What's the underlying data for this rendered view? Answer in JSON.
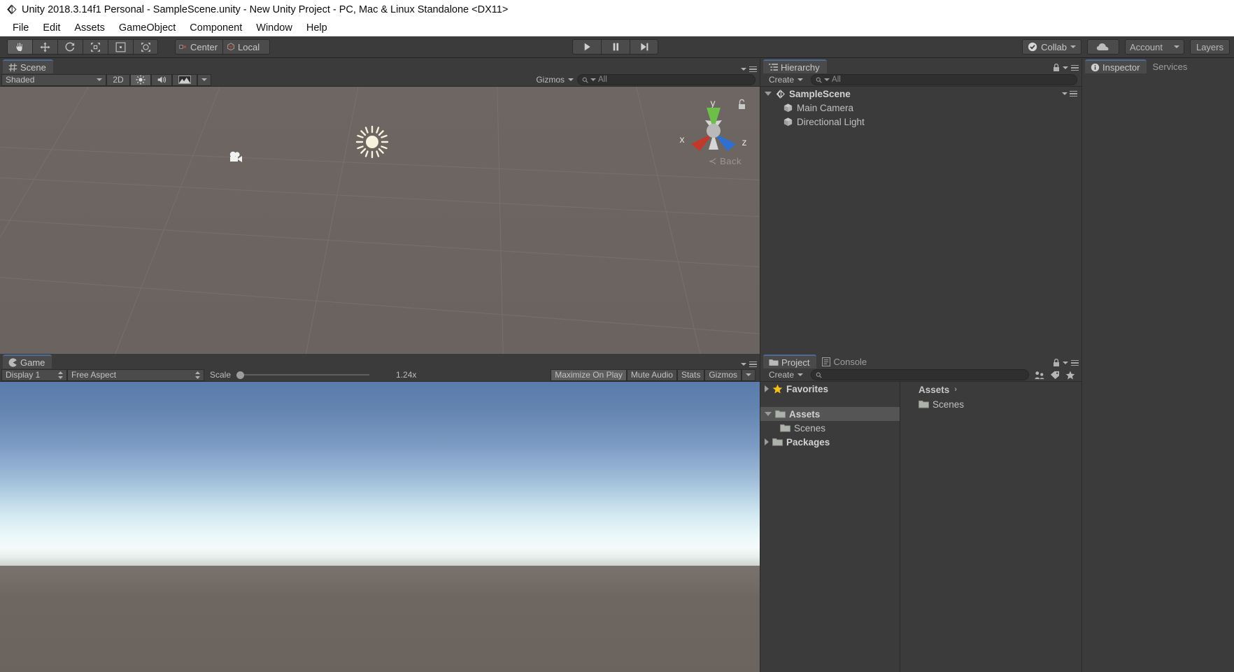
{
  "window": {
    "title": "Unity 2018.3.14f1 Personal - SampleScene.unity - New Unity Project - PC, Mac & Linux Standalone <DX11>",
    "logo_icon": "unity-logo-icon"
  },
  "menubar": {
    "items": [
      {
        "label": "File"
      },
      {
        "label": "Edit"
      },
      {
        "label": "Assets"
      },
      {
        "label": "GameObject"
      },
      {
        "label": "Component"
      },
      {
        "label": "Window"
      },
      {
        "label": "Help"
      }
    ]
  },
  "toolbar": {
    "tools": [
      {
        "name": "hand-tool",
        "icon": "hand-icon",
        "active": true
      },
      {
        "name": "move-tool",
        "icon": "move-arrows-icon",
        "active": false
      },
      {
        "name": "rotate-tool",
        "icon": "rotate-icon",
        "active": false
      },
      {
        "name": "scale-tool",
        "icon": "scale-icon",
        "active": false
      },
      {
        "name": "rect-tool",
        "icon": "rect-transform-icon",
        "active": false
      },
      {
        "name": "transform-tool",
        "icon": "transform-icon",
        "active": false
      }
    ],
    "pivot_mode": "Center",
    "pivot_rotation": "Local",
    "play_label": "play-button",
    "pause_label": "pause-button",
    "step_label": "step-button",
    "collab": "Collab",
    "cloud": "cloud-button",
    "account": "Account",
    "layers": "Layers"
  },
  "scene": {
    "tab": "Scene",
    "tab_icon": "scene-grid-icon",
    "draw_mode": "Shaded",
    "two_d": "2D",
    "lighting_icon": "lighting-icon",
    "audio_icon": "audio-icon",
    "effects_icon": "effects-icon",
    "gizmos": "Gizmos",
    "search_placeholder": "All",
    "search_value": "",
    "gizmo": {
      "axis_y": "y",
      "axis_x": "x",
      "axis_z": "z",
      "view_label": "Back",
      "lock_icon": "lock-open-icon"
    },
    "objects": [
      {
        "name": "directional-light-gizmo",
        "icon": "sun-icon"
      },
      {
        "name": "main-camera-gizmo",
        "icon": "camera-icon"
      }
    ]
  },
  "game": {
    "tab": "Game",
    "tab_icon": "game-pacman-icon",
    "display": "Display 1",
    "aspect": "Free Aspect",
    "scale_label": "Scale",
    "scale_value": "1.24x",
    "scale_percent": 3,
    "maximize_on_play": "Maximize On Play",
    "mute_audio": "Mute Audio",
    "stats": "Stats",
    "gizmos": "Gizmos",
    "sky_top_color": "#5a7cab",
    "horizon_color": "#f4fbfa",
    "ground_color": "#6b645e"
  },
  "hierarchy": {
    "tab": "Hierarchy",
    "tab_icon": "hierarchy-list-icon",
    "create_label": "Create",
    "search_placeholder": "All",
    "search_value": "",
    "lock_icon": "lock-icon",
    "menu_icon": "panel-menu-icon",
    "tree": [
      {
        "label": "SampleScene",
        "icon": "unity-scene-icon",
        "depth": 0,
        "expanded": true,
        "bold": true
      },
      {
        "label": "Main Camera",
        "icon": "gameobject-cube-icon",
        "depth": 1,
        "expanded": null,
        "bold": false
      },
      {
        "label": "Directional Light",
        "icon": "gameobject-cube-icon",
        "depth": 1,
        "expanded": null,
        "bold": false
      }
    ]
  },
  "inspector": {
    "tabs": [
      {
        "label": "Inspector",
        "icon": "info-icon",
        "active": true
      },
      {
        "label": "Services",
        "icon": "",
        "active": false
      }
    ],
    "empty": ""
  },
  "project": {
    "tabs": [
      {
        "label": "Project",
        "icon": "folder-icon",
        "active": true
      },
      {
        "label": "Console",
        "icon": "console-icon",
        "active": false
      }
    ],
    "create_label": "Create",
    "search_placeholder": "",
    "search_value": "",
    "toolbar_icons": [
      "asset-filter-icon",
      "label-tag-icon",
      "favorite-star-icon"
    ],
    "lock_icon": "lock-icon",
    "menu_icon": "panel-menu-icon",
    "tree": [
      {
        "label": "Favorites",
        "icon": "star-icon",
        "depth": 0,
        "expanded": false,
        "bold": true,
        "selected": false
      },
      {
        "label": "Assets",
        "icon": "folder-icon",
        "depth": 0,
        "expanded": true,
        "bold": true,
        "selected": true
      },
      {
        "label": "Scenes",
        "icon": "folder-icon",
        "depth": 1,
        "expanded": null,
        "bold": false,
        "selected": false
      },
      {
        "label": "Packages",
        "icon": "folder-icon",
        "depth": 0,
        "expanded": false,
        "bold": true,
        "selected": false
      }
    ],
    "breadcrumb": "Assets",
    "breadcrumb_chevron": "›",
    "items": [
      {
        "label": "Scenes",
        "icon": "folder-icon"
      }
    ]
  }
}
